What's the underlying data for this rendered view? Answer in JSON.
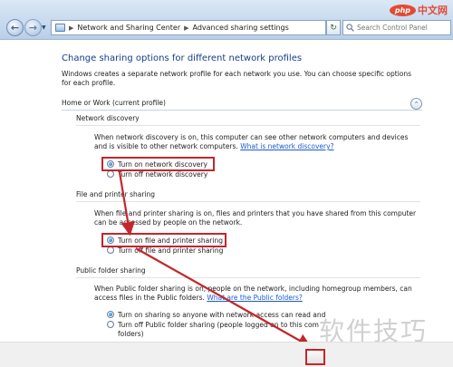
{
  "window": {
    "breadcrumb": [
      "Network and Sharing Center",
      "Advanced sharing settings"
    ],
    "breadcrumb_separator": "▶",
    "search_placeholder": "Search Control Panel",
    "watermark_logo": "php",
    "watermark_text": "中文网"
  },
  "page": {
    "title": "Change sharing options for different network profiles",
    "intro": "Windows creates a separate network profile for each network you use. You can choose specific options for each profile.",
    "profile_header": "Home or Work (current profile)"
  },
  "network_discovery": {
    "heading": "Network discovery",
    "description": "When network discovery is on, this computer can see other network computers and devices and is visible to other network computers.",
    "link": "What is network discovery?",
    "options": [
      {
        "label": "Turn on network discovery",
        "selected": true
      },
      {
        "label": "Turn off network discovery",
        "selected": false
      }
    ]
  },
  "file_printer_sharing": {
    "heading": "File and printer sharing",
    "description": "When file and printer sharing is on, files and printers that you have shared from this computer can be accessed by people on the network.",
    "options": [
      {
        "label": "Turn on file and printer sharing",
        "selected": true
      },
      {
        "label": "Turn off file and printer sharing",
        "selected": false
      }
    ]
  },
  "public_folder_sharing": {
    "heading": "Public folder sharing",
    "description_part1": "When Public folder sharing is on, people on the network, including homegroup members, can access files in the Public folders.",
    "link": "What are the Public folders?",
    "options": [
      {
        "label": "Turn on sharing so anyone with network access can read and",
        "selected": true
      },
      {
        "label": "Turn off Public folder sharing (people logged on to this com",
        "selected": false,
        "continuation": "folders)"
      }
    ]
  },
  "overlay": {
    "cn_watermark": "软件技巧",
    "highlight_color": "#c3262c"
  }
}
